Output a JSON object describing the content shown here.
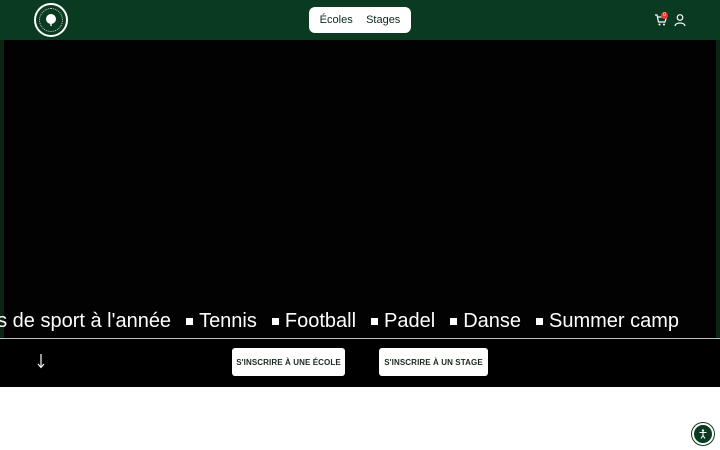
{
  "header": {
    "nav": [
      {
        "label": "Écoles"
      },
      {
        "label": "Stages"
      }
    ],
    "cart_count": "0",
    "colors": {
      "header_bg": "#0a3a1f",
      "badge": "#e53935"
    }
  },
  "marquee": {
    "items": [
      "es de sport à l'année",
      "Tennis",
      "Football",
      "Padel",
      "Danse",
      "Summer camp"
    ]
  },
  "actions": {
    "school_label": "S'INSCRIRE À UNE ÉCOLE",
    "camp_label": "S'INSCRIRE À UN STAGE"
  },
  "icons": [
    "logo",
    "cart-icon",
    "user-icon",
    "arrow-down-icon",
    "accessibility-icon"
  ]
}
